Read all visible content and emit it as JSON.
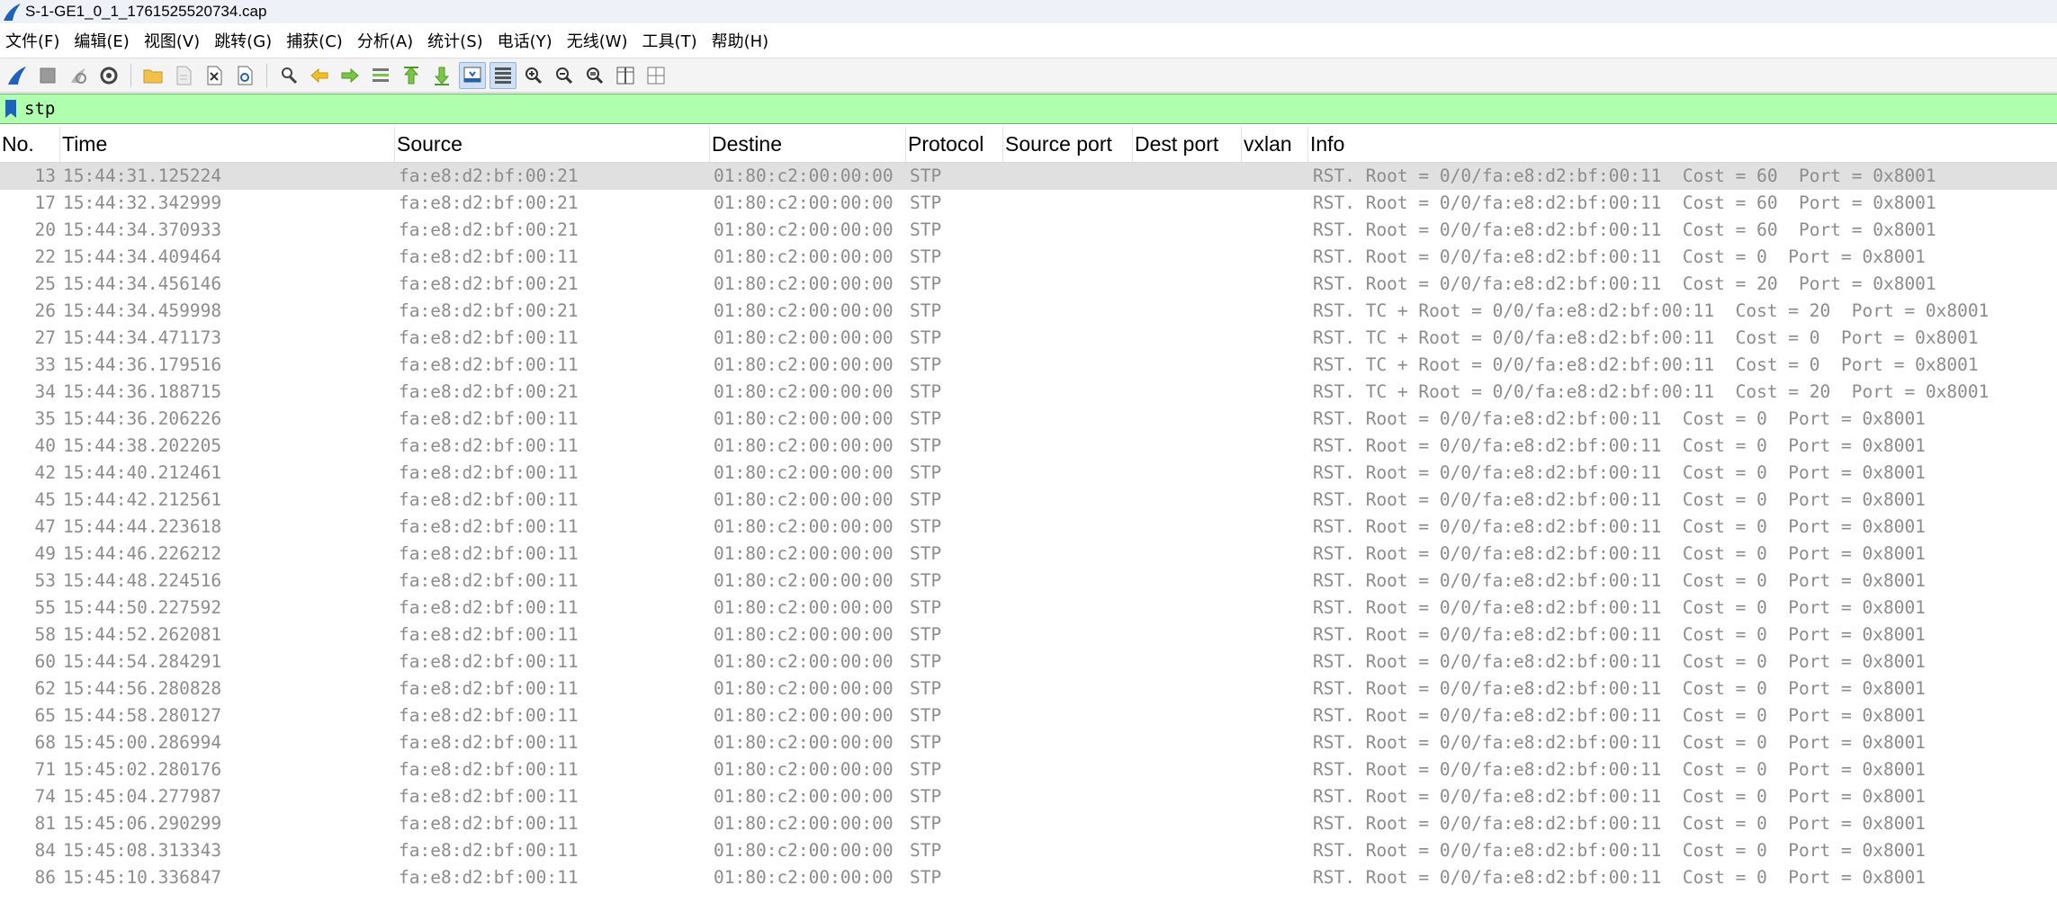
{
  "window": {
    "title": "S-1-GE1_0_1_1761525520734.cap"
  },
  "menu": [
    "文件(F)",
    "编辑(E)",
    "视图(V)",
    "跳转(G)",
    "捕获(C)",
    "分析(A)",
    "统计(S)",
    "电话(Y)",
    "无线(W)",
    "工具(T)",
    "帮助(H)"
  ],
  "filter": {
    "value": "stp"
  },
  "columns": [
    "No.",
    "Time",
    "Source",
    "Destine",
    "Protocol",
    "Source port",
    "Dest port",
    "vxlan",
    "Info"
  ],
  "rows": [
    {
      "no": "13",
      "time": "15:44:31.125224",
      "src": "fa:e8:d2:bf:00:21",
      "dst": "01:80:c2:00:00:00",
      "proto": "STP",
      "info": "RST. Root = 0/0/fa:e8:d2:bf:00:11  Cost = 60  Port = 0x8001"
    },
    {
      "no": "17",
      "time": "15:44:32.342999",
      "src": "fa:e8:d2:bf:00:21",
      "dst": "01:80:c2:00:00:00",
      "proto": "STP",
      "info": "RST. Root = 0/0/fa:e8:d2:bf:00:11  Cost = 60  Port = 0x8001"
    },
    {
      "no": "20",
      "time": "15:44:34.370933",
      "src": "fa:e8:d2:bf:00:21",
      "dst": "01:80:c2:00:00:00",
      "proto": "STP",
      "info": "RST. Root = 0/0/fa:e8:d2:bf:00:11  Cost = 60  Port = 0x8001"
    },
    {
      "no": "22",
      "time": "15:44:34.409464",
      "src": "fa:e8:d2:bf:00:11",
      "dst": "01:80:c2:00:00:00",
      "proto": "STP",
      "info": "RST. Root = 0/0/fa:e8:d2:bf:00:11  Cost = 0  Port = 0x8001"
    },
    {
      "no": "25",
      "time": "15:44:34.456146",
      "src": "fa:e8:d2:bf:00:21",
      "dst": "01:80:c2:00:00:00",
      "proto": "STP",
      "info": "RST. Root = 0/0/fa:e8:d2:bf:00:11  Cost = 20  Port = 0x8001"
    },
    {
      "no": "26",
      "time": "15:44:34.459998",
      "src": "fa:e8:d2:bf:00:21",
      "dst": "01:80:c2:00:00:00",
      "proto": "STP",
      "info": "RST. TC + Root = 0/0/fa:e8:d2:bf:00:11  Cost = 20  Port = 0x8001"
    },
    {
      "no": "27",
      "time": "15:44:34.471173",
      "src": "fa:e8:d2:bf:00:11",
      "dst": "01:80:c2:00:00:00",
      "proto": "STP",
      "info": "RST. TC + Root = 0/0/fa:e8:d2:bf:00:11  Cost = 0  Port = 0x8001"
    },
    {
      "no": "33",
      "time": "15:44:36.179516",
      "src": "fa:e8:d2:bf:00:11",
      "dst": "01:80:c2:00:00:00",
      "proto": "STP",
      "info": "RST. TC + Root = 0/0/fa:e8:d2:bf:00:11  Cost = 0  Port = 0x8001"
    },
    {
      "no": "34",
      "time": "15:44:36.188715",
      "src": "fa:e8:d2:bf:00:21",
      "dst": "01:80:c2:00:00:00",
      "proto": "STP",
      "info": "RST. TC + Root = 0/0/fa:e8:d2:bf:00:11  Cost = 20  Port = 0x8001"
    },
    {
      "no": "35",
      "time": "15:44:36.206226",
      "src": "fa:e8:d2:bf:00:11",
      "dst": "01:80:c2:00:00:00",
      "proto": "STP",
      "info": "RST. Root = 0/0/fa:e8:d2:bf:00:11  Cost = 0  Port = 0x8001"
    },
    {
      "no": "40",
      "time": "15:44:38.202205",
      "src": "fa:e8:d2:bf:00:11",
      "dst": "01:80:c2:00:00:00",
      "proto": "STP",
      "info": "RST. Root = 0/0/fa:e8:d2:bf:00:11  Cost = 0  Port = 0x8001"
    },
    {
      "no": "42",
      "time": "15:44:40.212461",
      "src": "fa:e8:d2:bf:00:11",
      "dst": "01:80:c2:00:00:00",
      "proto": "STP",
      "info": "RST. Root = 0/0/fa:e8:d2:bf:00:11  Cost = 0  Port = 0x8001"
    },
    {
      "no": "45",
      "time": "15:44:42.212561",
      "src": "fa:e8:d2:bf:00:11",
      "dst": "01:80:c2:00:00:00",
      "proto": "STP",
      "info": "RST. Root = 0/0/fa:e8:d2:bf:00:11  Cost = 0  Port = 0x8001"
    },
    {
      "no": "47",
      "time": "15:44:44.223618",
      "src": "fa:e8:d2:bf:00:11",
      "dst": "01:80:c2:00:00:00",
      "proto": "STP",
      "info": "RST. Root = 0/0/fa:e8:d2:bf:00:11  Cost = 0  Port = 0x8001"
    },
    {
      "no": "49",
      "time": "15:44:46.226212",
      "src": "fa:e8:d2:bf:00:11",
      "dst": "01:80:c2:00:00:00",
      "proto": "STP",
      "info": "RST. Root = 0/0/fa:e8:d2:bf:00:11  Cost = 0  Port = 0x8001"
    },
    {
      "no": "53",
      "time": "15:44:48.224516",
      "src": "fa:e8:d2:bf:00:11",
      "dst": "01:80:c2:00:00:00",
      "proto": "STP",
      "info": "RST. Root = 0/0/fa:e8:d2:bf:00:11  Cost = 0  Port = 0x8001"
    },
    {
      "no": "55",
      "time": "15:44:50.227592",
      "src": "fa:e8:d2:bf:00:11",
      "dst": "01:80:c2:00:00:00",
      "proto": "STP",
      "info": "RST. Root = 0/0/fa:e8:d2:bf:00:11  Cost = 0  Port = 0x8001"
    },
    {
      "no": "58",
      "time": "15:44:52.262081",
      "src": "fa:e8:d2:bf:00:11",
      "dst": "01:80:c2:00:00:00",
      "proto": "STP",
      "info": "RST. Root = 0/0/fa:e8:d2:bf:00:11  Cost = 0  Port = 0x8001"
    },
    {
      "no": "60",
      "time": "15:44:54.284291",
      "src": "fa:e8:d2:bf:00:11",
      "dst": "01:80:c2:00:00:00",
      "proto": "STP",
      "info": "RST. Root = 0/0/fa:e8:d2:bf:00:11  Cost = 0  Port = 0x8001"
    },
    {
      "no": "62",
      "time": "15:44:56.280828",
      "src": "fa:e8:d2:bf:00:11",
      "dst": "01:80:c2:00:00:00",
      "proto": "STP",
      "info": "RST. Root = 0/0/fa:e8:d2:bf:00:11  Cost = 0  Port = 0x8001"
    },
    {
      "no": "65",
      "time": "15:44:58.280127",
      "src": "fa:e8:d2:bf:00:11",
      "dst": "01:80:c2:00:00:00",
      "proto": "STP",
      "info": "RST. Root = 0/0/fa:e8:d2:bf:00:11  Cost = 0  Port = 0x8001"
    },
    {
      "no": "68",
      "time": "15:45:00.286994",
      "src": "fa:e8:d2:bf:00:11",
      "dst": "01:80:c2:00:00:00",
      "proto": "STP",
      "info": "RST. Root = 0/0/fa:e8:d2:bf:00:11  Cost = 0  Port = 0x8001"
    },
    {
      "no": "71",
      "time": "15:45:02.280176",
      "src": "fa:e8:d2:bf:00:11",
      "dst": "01:80:c2:00:00:00",
      "proto": "STP",
      "info": "RST. Root = 0/0/fa:e8:d2:bf:00:11  Cost = 0  Port = 0x8001"
    },
    {
      "no": "74",
      "time": "15:45:04.277987",
      "src": "fa:e8:d2:bf:00:11",
      "dst": "01:80:c2:00:00:00",
      "proto": "STP",
      "info": "RST. Root = 0/0/fa:e8:d2:bf:00:11  Cost = 0  Port = 0x8001"
    },
    {
      "no": "81",
      "time": "15:45:06.290299",
      "src": "fa:e8:d2:bf:00:11",
      "dst": "01:80:c2:00:00:00",
      "proto": "STP",
      "info": "RST. Root = 0/0/fa:e8:d2:bf:00:11  Cost = 0  Port = 0x8001"
    },
    {
      "no": "84",
      "time": "15:45:08.313343",
      "src": "fa:e8:d2:bf:00:11",
      "dst": "01:80:c2:00:00:00",
      "proto": "STP",
      "info": "RST. Root = 0/0/fa:e8:d2:bf:00:11  Cost = 0  Port = 0x8001"
    },
    {
      "no": "86",
      "time": "15:45:10.336847",
      "src": "fa:e8:d2:bf:00:11",
      "dst": "01:80:c2:00:00:00",
      "proto": "STP",
      "info": "RST. Root = 0/0/fa:e8:d2:bf:00:11  Cost = 0  Port = 0x8001"
    }
  ],
  "selected_row": 0,
  "colors": {
    "filter_valid_bg": "#afffaf",
    "row_text": "#8c8c8c",
    "selected_row_bg": "#e0e0e0",
    "accent_blue": "#1e63b8"
  },
  "toolbar_icons": [
    "shark-fin-start-icon",
    "stop-icon",
    "restart-icon",
    "capture-options-icon",
    "open-folder-icon",
    "save-file-icon",
    "close-file-icon",
    "reload-icon",
    "find-icon",
    "go-back-icon",
    "go-forward-icon",
    "go-to-packet-icon",
    "first-packet-icon",
    "last-packet-icon",
    "autoscroll-icon",
    "colorize-icon",
    "zoom-in-icon",
    "zoom-out-icon",
    "zoom-reset-icon",
    "resize-columns-icon",
    "layout-icon"
  ]
}
